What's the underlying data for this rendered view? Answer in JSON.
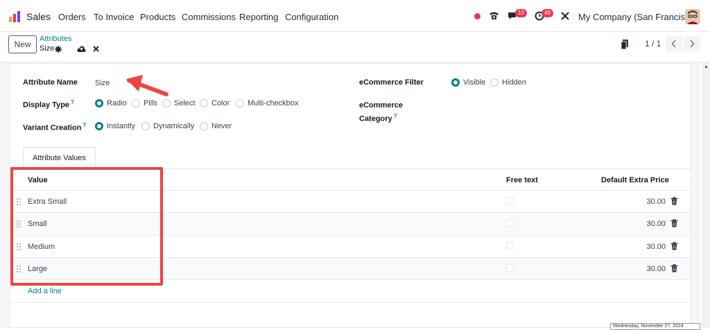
{
  "topbar": {
    "app_name": "Sales",
    "menu": [
      "Orders",
      "To Invoice",
      "Products",
      "Commissions",
      "Reporting",
      "Configuration"
    ],
    "chat_badge": "10",
    "activity_badge": "49",
    "company": "My Company (San Francisco)",
    "colors": {
      "status_dot": "#e8384f",
      "badge": "#e8384f"
    }
  },
  "control_panel": {
    "new_label": "New",
    "breadcrumb": "Attributes",
    "record_name": "Size",
    "pager": "1 / 1"
  },
  "form": {
    "attribute_name_label": "Attribute Name",
    "attribute_name_value": "Size",
    "display_type_label": "Display Type",
    "display_type_options": [
      "Radio",
      "Pills",
      "Select",
      "Color",
      "Multi-checkbox"
    ],
    "display_type_selected": "Radio",
    "variant_creation_label": "Variant Creation",
    "variant_creation_options": [
      "Instantly",
      "Dynamically",
      "Never"
    ],
    "variant_creation_selected": "Instantly",
    "ecommerce_filter_label": "eCommerce Filter",
    "ecommerce_filter_options": [
      "Visible",
      "Hidden"
    ],
    "ecommerce_filter_selected": "Visible",
    "ecommerce_category_label_line1": "eCommerce",
    "ecommerce_category_label_line2": "Category",
    "tooltip_mark": "?"
  },
  "tabs": {
    "attribute_values": "Attribute Values"
  },
  "table": {
    "headers": {
      "value": "Value",
      "free_text": "Free text",
      "default_extra_price": "Default Extra Price"
    },
    "rows": [
      {
        "name": "Extra Small",
        "price": "30.00"
      },
      {
        "name": "Small",
        "price": "30.00"
      },
      {
        "name": "Medium",
        "price": "30.00"
      },
      {
        "name": "Large",
        "price": "30.00"
      }
    ],
    "add_line": "Add a line"
  },
  "footer_date": "Wednesday, November 27, 2024",
  "colors": {
    "accent": "#017e84",
    "brand": "#714b67",
    "annotation": "#ef4444"
  }
}
